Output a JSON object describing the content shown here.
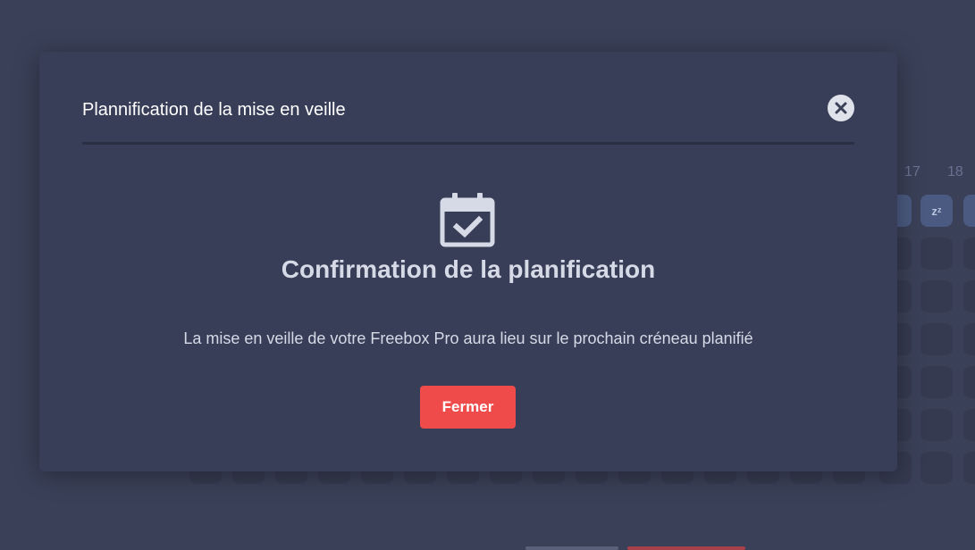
{
  "background": {
    "hour_labels": [
      "17",
      "18"
    ],
    "sleep_label": "zᶻ"
  },
  "modal": {
    "title": "Plannification de la mise en veille",
    "close_icon": "close-icon",
    "status_icon": "calendar-check-icon",
    "heading": "Confirmation de la planification",
    "message": "La mise en veille de votre Freebox Pro aura lieu sur le prochain créneau planifié",
    "close_button_label": "Fermer"
  },
  "colors": {
    "accent": "#ef4b4b",
    "modal_bg": "#383e58",
    "page_bg": "#3a4058"
  }
}
